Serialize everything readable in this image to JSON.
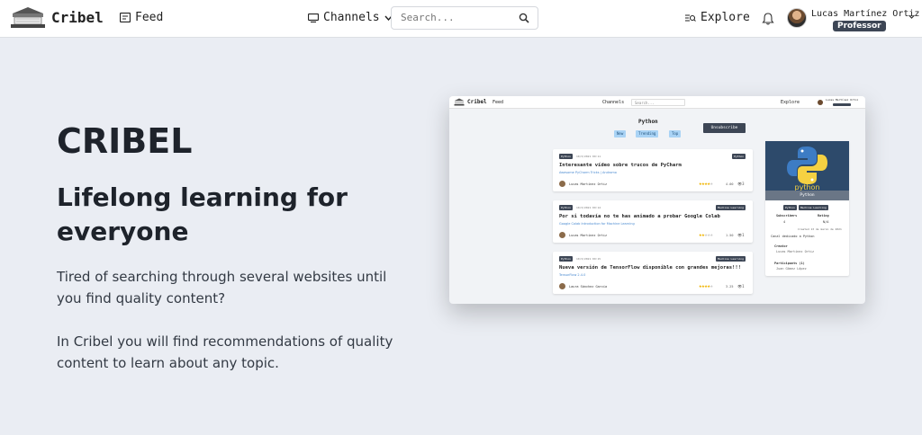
{
  "navbar": {
    "brand": "Cribel",
    "feed_label": "Feed",
    "channels_label": "Channels",
    "search_placeholder": "Search...",
    "explore_label": "Explore",
    "user_name": "Lucas Martínez Ortiz",
    "user_role": "Professor"
  },
  "hero": {
    "title": "CRIBEL",
    "subtitle": "Lifelong learning for everyone",
    "paragraph1": "Tired of searching through several websites until you find quality content?",
    "paragraph2": "In Cribel you will find recommendations of quality content to learn about any topic."
  },
  "preview": {
    "brand": "Cribel",
    "feed": "Feed",
    "channels": "Channels",
    "search": "Search...",
    "explore": "Explore",
    "user": "Lucas Martínez Ortiz",
    "channel_title": "Python",
    "tabs": [
      "New",
      "Trending",
      "Top"
    ],
    "unsubscribe": "Unsubscribe",
    "cards": [
      {
        "tag": "Python",
        "date": "10/3/2021 09:11",
        "right_tag": "Python",
        "title": "Interesante vídeo sobre trucos de PyCharm",
        "sub": "Awesome PyCharm Tricks | Andromo",
        "author": "Lucas Martínez Ortiz",
        "rating_stars": 4,
        "rating": "4.00",
        "views": "3"
      },
      {
        "tag": "Python",
        "date": "10/3/2021 09:14",
        "right_tag": "Machine Learning",
        "title": "Por si todavía no te has animado a probar Google Colab",
        "sub": "Google Colab Introduction for Machine Learning",
        "author": "Lucas Martínez Ortiz",
        "rating_stars": 2,
        "rating": "1.50",
        "views": "1"
      },
      {
        "tag": "Python",
        "date": "10/3/2021 09:15",
        "right_tag": "Machine Learning",
        "title": "Nueva versión de TensorFlow disponible con grandes mejoras!!!",
        "sub": "TensorFlow 2.4.0",
        "author": "Laura Sánchez García",
        "rating_stars": 4,
        "rating": "3.25",
        "views": "1"
      }
    ],
    "side": {
      "logo_text": "python",
      "name": "Python",
      "tags": [
        "Python",
        "Machine Learning"
      ],
      "subscribers_label": "Subscribers",
      "subscribers": "4",
      "rating_label": "Rating",
      "rating": "N/A",
      "created": "Created 13 de marzo de 2021",
      "desc": "Canal dedicado a Python",
      "creator_label": "Creator",
      "creator": "Lucas Martínez Ortiz",
      "participants_label": "Participants (1)",
      "participant": "Juan Gómez López"
    }
  }
}
